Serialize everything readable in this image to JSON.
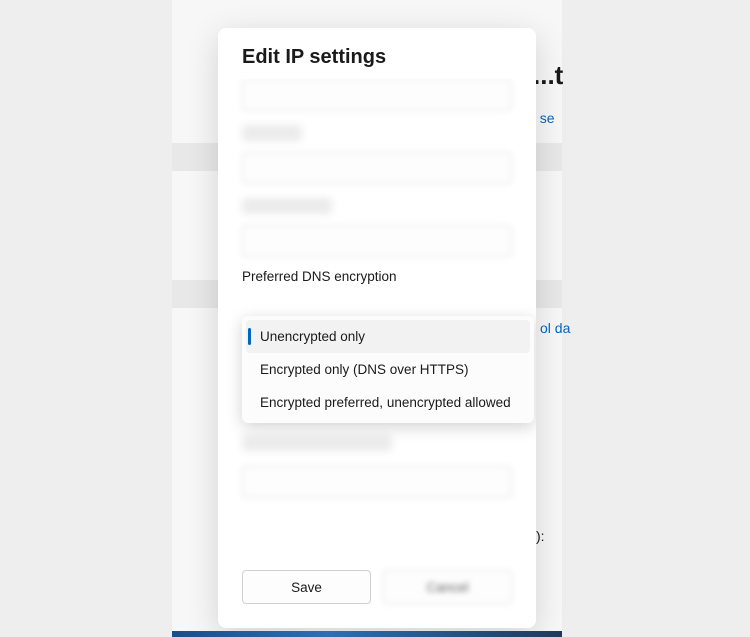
{
  "background": {
    "heading_fragment": "...t",
    "link1_fragment": "ty se",
    "link2_fragment": "ol da",
    "paren_fragment": "):"
  },
  "modal": {
    "title": "Edit IP settings",
    "preferred_dns_label": "Preferred DNS encryption",
    "dropdown": {
      "selected_index": 0,
      "options": [
        "Unencrypted only",
        "Encrypted only (DNS over HTTPS)",
        "Encrypted preferred, unencrypted allowed"
      ]
    },
    "buttons": {
      "save": "Save",
      "cancel": "Cancel"
    }
  }
}
